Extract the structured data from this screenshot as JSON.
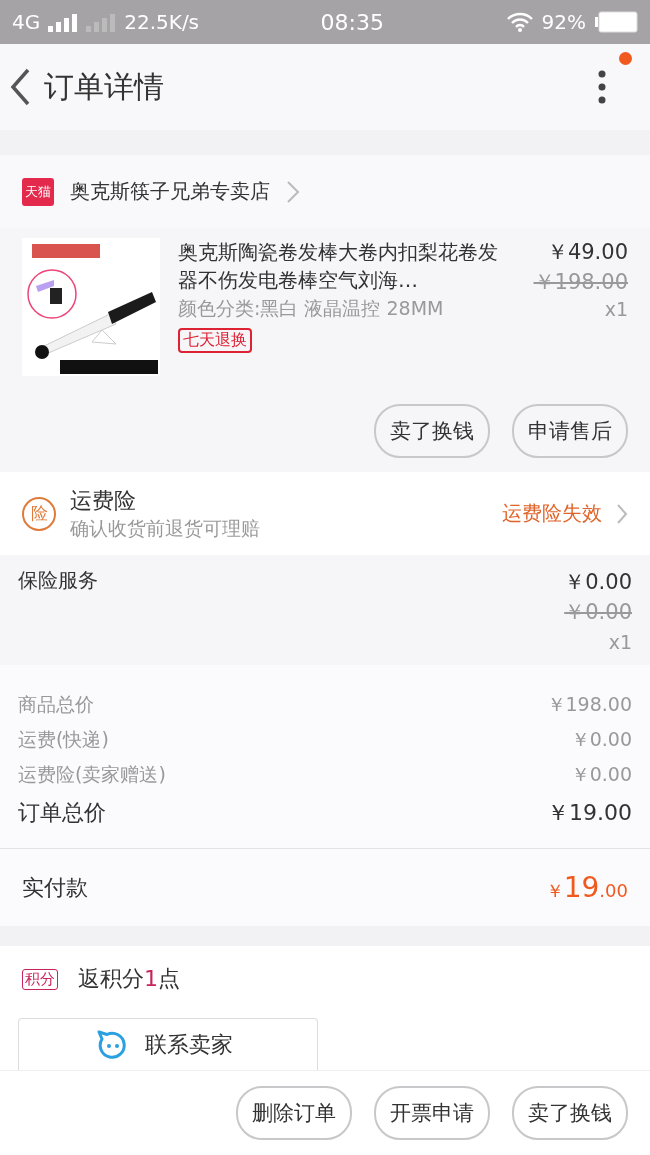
{
  "status_bar": {
    "network": "4G",
    "speed": "22.5K/s",
    "time": "08:35",
    "battery": "92%"
  },
  "header": {
    "title": "订单详情",
    "notification_dot": true
  },
  "shop": {
    "badge": "天猫",
    "name": "奥克斯筷子兄弟专卖店"
  },
  "product": {
    "image": {
      "kind": "picture"
    },
    "title": "奥克斯陶瓷卷发棒大卷内扣梨花卷发器不伤发电卷棒空气刘海…",
    "sku": "颜色分类:黑白 液晶温控 28MM",
    "tag": "七天退换",
    "price": "￥49.00",
    "original_price": "￥198.00",
    "quantity": "x1",
    "actions": [
      "卖了换钱",
      "申请售后"
    ]
  },
  "shipping_insurance": {
    "icon": "险",
    "title": "运费险",
    "subtitle": "确认收货前退货可理赔",
    "status": "运费险失效"
  },
  "insurance_service": {
    "label": "保险服务",
    "price": "￥0.00",
    "original_price": "￥0.00",
    "quantity": "x1"
  },
  "summary": [
    {
      "label": "商品总价",
      "value": "￥198.00",
      "kind": "minor"
    },
    {
      "label": "运费(快递)",
      "value": "￥0.00",
      "kind": "minor"
    },
    {
      "label": "运费险(卖家赠送)",
      "value": "￥0.00",
      "kind": "minor"
    },
    {
      "label": "订单总价",
      "value": "￥19.00",
      "kind": "total"
    }
  ],
  "paid": {
    "label": "实付款",
    "currency": "￥",
    "amount": "19",
    "decimals": ".00"
  },
  "points": {
    "badge": "积分",
    "text_before": "返积分",
    "count": "1",
    "text_after": "点"
  },
  "contact": {
    "label": "联系卖家"
  },
  "bottom_actions": [
    "删除订单",
    "开票申请",
    "卖了换钱"
  ]
}
